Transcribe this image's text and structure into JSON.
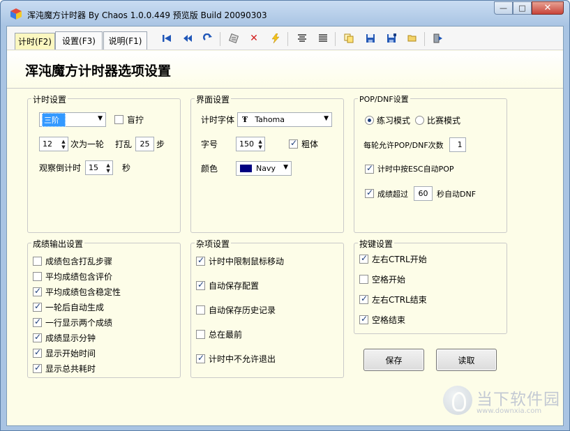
{
  "window": {
    "title": "浑沌魔方计时器 By Chaos 1.0.0.449 预览版 Build 20090303",
    "minimize_symbol": "—",
    "maximize_symbol": "□",
    "close_symbol": "✕"
  },
  "tabs": [
    {
      "label": "计时(F2)",
      "active": true
    },
    {
      "label": "设置(F3)",
      "active": false
    },
    {
      "label": "说明(F1)",
      "active": false
    }
  ],
  "toolbar_icons": [
    "skip-to-start-icon",
    "rewind-icon",
    "redo-icon",
    "scramble-icon",
    "delete-icon",
    "lightning-icon",
    "align-lines-icon",
    "list-lines-icon",
    "copy-icon",
    "save-icon",
    "save-as-icon",
    "open-folder-icon",
    "exit-icon"
  ],
  "page_title": "浑沌魔方计时器选项设置",
  "timer_settings": {
    "title": "计时设置",
    "puzzle_value": "三阶",
    "blind_label": "盲拧",
    "blind_checked": false,
    "rounds_value": "12",
    "rounds_label": "次为一轮",
    "scramble_label": "打乱",
    "scramble_value": "25",
    "scramble_unit": "步",
    "inspect_label": "观察倒计时",
    "inspect_value": "15",
    "inspect_unit": "秒"
  },
  "interface_settings": {
    "title": "界面设置",
    "font_label": "计时字体",
    "font_value": "Tahoma",
    "size_label": "字号",
    "size_value": "150",
    "bold_label": "粗体",
    "bold_checked": true,
    "color_label": "颜色",
    "color_value": "Navy",
    "color_hex": "#000080"
  },
  "pop_settings": {
    "title": "POP/DNF设置",
    "mode_practice": "练习模式",
    "mode_competition": "比赛模式",
    "practice_selected": true,
    "pop_per_round_label": "每轮允许POP/DNF次数",
    "pop_per_round_value": "1",
    "esc_pop_label": "计时中按ESC自动POP",
    "esc_pop_checked": true,
    "auto_dnf_label": "成绩超过",
    "auto_dnf_value": "60",
    "auto_dnf_suffix": "秒自动DNF",
    "auto_dnf_checked": true
  },
  "output_settings": {
    "title": "成绩输出设置",
    "items": [
      {
        "label": "成绩包含打乱步骤",
        "checked": false
      },
      {
        "label": "平均成绩包含评价",
        "checked": false
      },
      {
        "label": "平均成绩包含稳定性",
        "checked": true
      },
      {
        "label": "一轮后自动生成",
        "checked": true
      },
      {
        "label": "一行显示两个成绩",
        "checked": true
      },
      {
        "label": "成绩显示分钟",
        "checked": true
      },
      {
        "label": "显示开始时间",
        "checked": true
      },
      {
        "label": "显示总共耗时",
        "checked": true
      }
    ]
  },
  "misc_settings": {
    "title": "杂项设置",
    "items": [
      {
        "label": "计时中限制鼠标移动",
        "checked": true
      },
      {
        "label": "自动保存配置",
        "checked": true
      },
      {
        "label": "自动保存历史记录",
        "checked": false
      },
      {
        "label": "总在最前",
        "checked": false
      },
      {
        "label": "计时中不允许退出",
        "checked": true
      }
    ]
  },
  "key_settings": {
    "title": "按键设置",
    "items": [
      {
        "label": "左右CTRL开始",
        "checked": true
      },
      {
        "label": "空格开始",
        "checked": false
      },
      {
        "label": "左右CTRL结束",
        "checked": true
      },
      {
        "label": "空格结束",
        "checked": true
      }
    ]
  },
  "buttons": {
    "save": "保存",
    "load": "读取"
  },
  "watermark": {
    "text": "当下软件园",
    "url": "www.downxia.com"
  }
}
